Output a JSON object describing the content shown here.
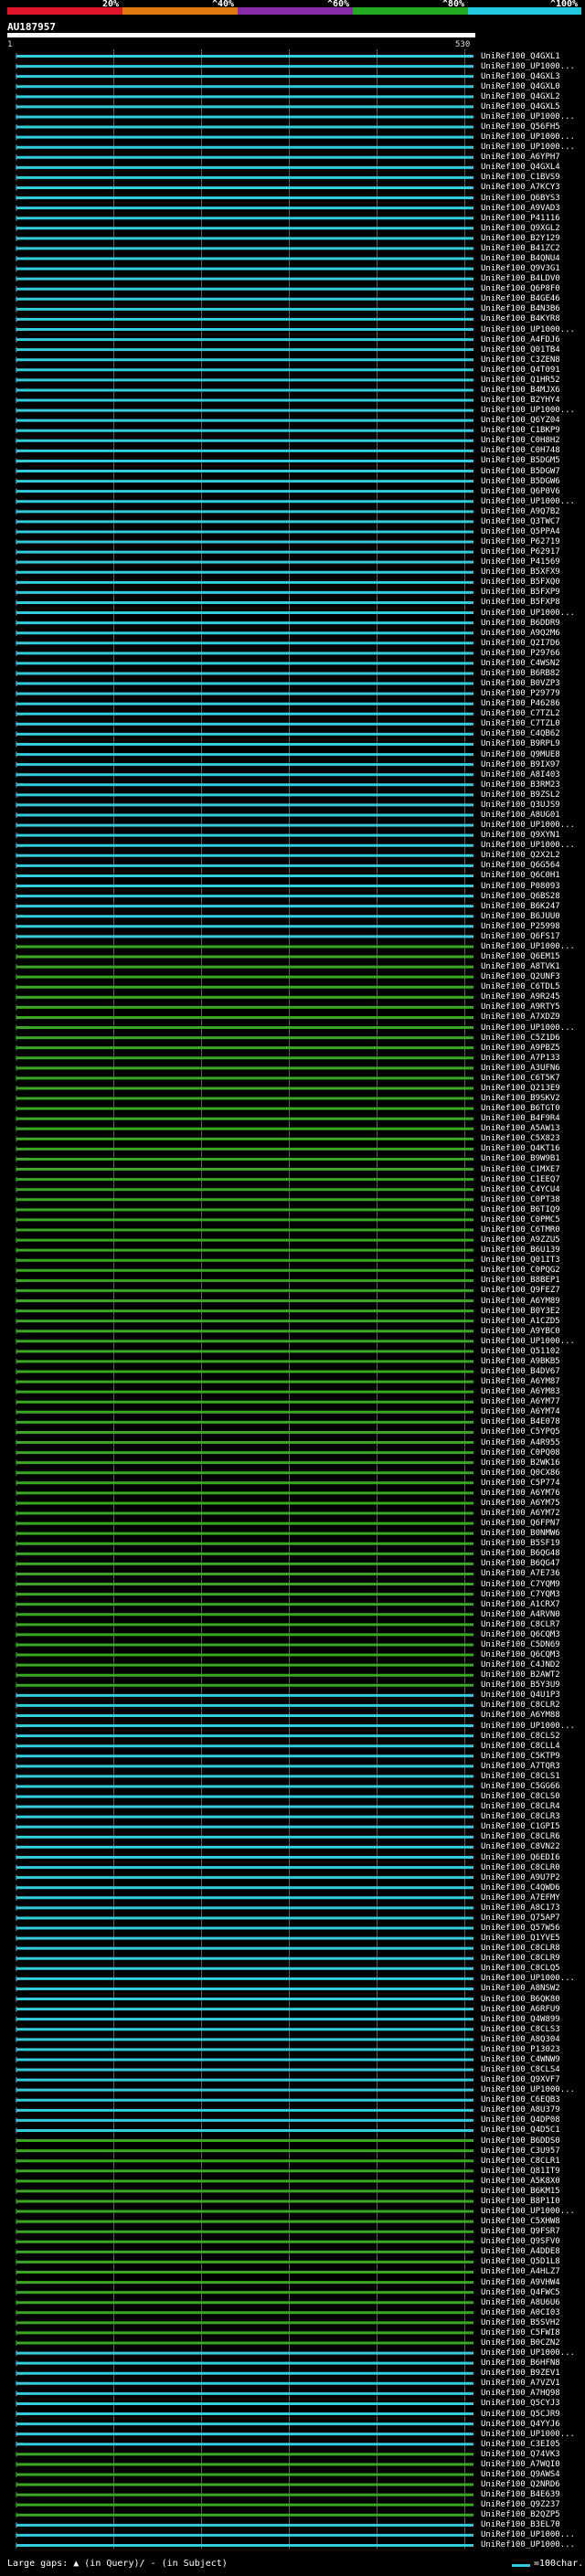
{
  "scale": {
    "ticks": [
      "20%",
      "^40%",
      "^60%",
      "^80%",
      "^100%"
    ],
    "colors": [
      "#e0152b",
      "#e07a10",
      "#8a2ba8",
      "#22aa22",
      "#22c8e0"
    ]
  },
  "query": {
    "title": "AU187957",
    "start": "1",
    "end": "530"
  },
  "legend": {
    "text": "Large gaps: ▲ (in Query)/ - (in Subject)",
    "unit": "=100char."
  },
  "colors": {
    "cyan": "#33ccdd",
    "green": "#3aa820",
    "white": "#ffffff"
  },
  "hits": [
    {
      "label": "UniRef100_Q4GXL1",
      "color": "cyan"
    },
    {
      "label": "UniRef100_UP1000...",
      "color": "cyan"
    },
    {
      "label": "UniRef100_Q4GXL3",
      "color": "cyan"
    },
    {
      "label": "UniRef100_Q4GXL0",
      "color": "cyan"
    },
    {
      "label": "UniRef100_Q4GXL2",
      "color": "cyan"
    },
    {
      "label": "UniRef100_Q4GXL5",
      "color": "cyan"
    },
    {
      "label": "UniRef100_UP1000...",
      "color": "cyan"
    },
    {
      "label": "UniRef100_Q56FH5",
      "color": "cyan"
    },
    {
      "label": "UniRef100_UP1000...",
      "color": "cyan"
    },
    {
      "label": "UniRef100_UP1000...",
      "color": "cyan"
    },
    {
      "label": "UniRef100_A6YPH7",
      "color": "cyan"
    },
    {
      "label": "UniRef100_Q4GXL4",
      "color": "cyan"
    },
    {
      "label": "UniRef100_C1BVS9",
      "color": "cyan"
    },
    {
      "label": "UniRef100_A7KCY3",
      "color": "cyan"
    },
    {
      "label": "UniRef100_Q6BYS3",
      "color": "cyan"
    },
    {
      "label": "UniRef100_A9VAD3",
      "color": "cyan"
    },
    {
      "label": "UniRef100_P41116",
      "color": "cyan"
    },
    {
      "label": "UniRef100_Q9XGL2",
      "color": "cyan"
    },
    {
      "label": "UniRef100_B2Y129",
      "color": "cyan"
    },
    {
      "label": "UniRef100_B41ZC2",
      "color": "cyan"
    },
    {
      "label": "UniRef100_B4QNU4",
      "color": "cyan"
    },
    {
      "label": "UniRef100_Q9V3G1",
      "color": "cyan"
    },
    {
      "label": "UniRef100_B4LDV0",
      "color": "cyan"
    },
    {
      "label": "UniRef100_Q6P8F0",
      "color": "cyan"
    },
    {
      "label": "UniRef100_B4GE46",
      "color": "cyan"
    },
    {
      "label": "UniRef100_B4N3B6",
      "color": "cyan"
    },
    {
      "label": "UniRef100_B4KYR8",
      "color": "cyan"
    },
    {
      "label": "UniRef100_UP1000...",
      "color": "cyan"
    },
    {
      "label": "UniRef100_A4FDJ6",
      "color": "cyan"
    },
    {
      "label": "UniRef100_Q01TB4",
      "color": "cyan"
    },
    {
      "label": "UniRef100_C3ZEN8",
      "color": "cyan"
    },
    {
      "label": "UniRef100_Q4T091",
      "color": "cyan"
    },
    {
      "label": "UniRef100_Q1HR52",
      "color": "cyan"
    },
    {
      "label": "UniRef100_B4MJX6",
      "color": "cyan"
    },
    {
      "label": "UniRef100_B2YHY4",
      "color": "cyan"
    },
    {
      "label": "UniRef100_UP1000...",
      "color": "cyan"
    },
    {
      "label": "UniRef100_Q6YZ04",
      "color": "cyan"
    },
    {
      "label": "UniRef100_C1BKP9",
      "color": "cyan"
    },
    {
      "label": "UniRef100_C0H8H2",
      "color": "cyan"
    },
    {
      "label": "UniRef100_C0H748",
      "color": "cyan"
    },
    {
      "label": "UniRef100_B5DGM5",
      "color": "cyan"
    },
    {
      "label": "UniRef100_B5DGW7",
      "color": "cyan"
    },
    {
      "label": "UniRef100_B5DGW6",
      "color": "cyan"
    },
    {
      "label": "UniRef100_Q6P0V6",
      "color": "cyan"
    },
    {
      "label": "UniRef100_UP1000...",
      "color": "cyan"
    },
    {
      "label": "UniRef100_A9Q7B2",
      "color": "cyan"
    },
    {
      "label": "UniRef100_Q3TWC7",
      "color": "cyan"
    },
    {
      "label": "UniRef100_Q5PPA4",
      "color": "cyan"
    },
    {
      "label": "UniRef100_P62719",
      "color": "cyan"
    },
    {
      "label": "UniRef100_P62917",
      "color": "cyan"
    },
    {
      "label": "UniRef100_P41569",
      "color": "cyan"
    },
    {
      "label": "UniRef100_B5XFX9",
      "color": "cyan"
    },
    {
      "label": "UniRef100_B5FXQ0",
      "color": "cyan"
    },
    {
      "label": "UniRef100_B5FXP9",
      "color": "cyan"
    },
    {
      "label": "UniRef100_B5FXP8",
      "color": "cyan"
    },
    {
      "label": "UniRef100_UP1000...",
      "color": "cyan"
    },
    {
      "label": "UniRef100_B6DDR9",
      "color": "cyan"
    },
    {
      "label": "UniRef100_A9Q2M6",
      "color": "cyan"
    },
    {
      "label": "UniRef100_Q2I7D6",
      "color": "cyan"
    },
    {
      "label": "UniRef100_P29766",
      "color": "cyan"
    },
    {
      "label": "UniRef100_C4WSN2",
      "color": "cyan"
    },
    {
      "label": "UniRef100_B6RB82",
      "color": "cyan"
    },
    {
      "label": "UniRef100_B0VZP3",
      "color": "cyan"
    },
    {
      "label": "UniRef100_P29779",
      "color": "cyan"
    },
    {
      "label": "UniRef100_P46286",
      "color": "cyan"
    },
    {
      "label": "UniRef100_C7TZL2",
      "color": "cyan"
    },
    {
      "label": "UniRef100_C7TZL0",
      "color": "cyan"
    },
    {
      "label": "UniRef100_C4QB62",
      "color": "cyan"
    },
    {
      "label": "UniRef100_B9RPL9",
      "color": "cyan"
    },
    {
      "label": "UniRef100_Q9MUE8",
      "color": "cyan"
    },
    {
      "label": "UniRef100_B9IX97",
      "color": "cyan"
    },
    {
      "label": "UniRef100_A8I403",
      "color": "cyan"
    },
    {
      "label": "UniRef100_B3RM23",
      "color": "cyan"
    },
    {
      "label": "UniRef100_B9ZSL2",
      "color": "cyan"
    },
    {
      "label": "UniRef100_Q3UJS9",
      "color": "cyan"
    },
    {
      "label": "UniRef100_A8UG01",
      "color": "cyan"
    },
    {
      "label": "UniRef100_UP1000...",
      "color": "cyan"
    },
    {
      "label": "UniRef100_Q9XYN1",
      "color": "cyan"
    },
    {
      "label": "UniRef100_UP1000...",
      "color": "cyan"
    },
    {
      "label": "UniRef100_Q2X2L2",
      "color": "cyan"
    },
    {
      "label": "UniRef100_Q6G564",
      "color": "cyan"
    },
    {
      "label": "UniRef100_Q6C0H1",
      "color": "cyan"
    },
    {
      "label": "UniRef100_P08093",
      "color": "cyan"
    },
    {
      "label": "UniRef100_Q6BS28",
      "color": "cyan"
    },
    {
      "label": "UniRef100_B6K247",
      "color": "cyan"
    },
    {
      "label": "UniRef100_B6JUU0",
      "color": "cyan"
    },
    {
      "label": "UniRef100_P25998",
      "color": "cyan"
    },
    {
      "label": "UniRef100_Q6FS17",
      "color": "cyan"
    },
    {
      "label": "UniRef100_UP1000...",
      "color": "green"
    },
    {
      "label": "UniRef100_Q6EM15",
      "color": "green"
    },
    {
      "label": "UniRef100_A8TVK1",
      "color": "green"
    },
    {
      "label": "UniRef100_Q2UNF3",
      "color": "green"
    },
    {
      "label": "UniRef100_C6TDL5",
      "color": "green"
    },
    {
      "label": "UniRef100_A9R245",
      "color": "green"
    },
    {
      "label": "UniRef100_A9RTY5",
      "color": "green"
    },
    {
      "label": "UniRef100_A7XDZ9",
      "color": "green"
    },
    {
      "label": "UniRef100_UP1000...",
      "color": "green"
    },
    {
      "label": "UniRef100_C5Z1D6",
      "color": "green"
    },
    {
      "label": "UniRef100_A9PBZ5",
      "color": "green"
    },
    {
      "label": "UniRef100_A7P133",
      "color": "green"
    },
    {
      "label": "UniRef100_A3UFN6",
      "color": "green"
    },
    {
      "label": "UniRef100_C6T5K7",
      "color": "green"
    },
    {
      "label": "UniRef100_Q213E9",
      "color": "green"
    },
    {
      "label": "UniRef100_B9SKV2",
      "color": "green"
    },
    {
      "label": "UniRef100_B6TGT0",
      "color": "green"
    },
    {
      "label": "UniRef100_B4F9R4",
      "color": "green"
    },
    {
      "label": "UniRef100_A5AW13",
      "color": "green"
    },
    {
      "label": "UniRef100_C5X823",
      "color": "green"
    },
    {
      "label": "UniRef100_Q4KT16",
      "color": "green"
    },
    {
      "label": "UniRef100_B9W9B1",
      "color": "green"
    },
    {
      "label": "UniRef100_C1MXE7",
      "color": "green"
    },
    {
      "label": "UniRef100_C1EEQ7",
      "color": "green"
    },
    {
      "label": "UniRef100_C4YCU4",
      "color": "green"
    },
    {
      "label": "UniRef100_C0PT38",
      "color": "green"
    },
    {
      "label": "UniRef100_B6TIQ9",
      "color": "green"
    },
    {
      "label": "UniRef100_C0PMC5",
      "color": "green"
    },
    {
      "label": "UniRef100_C6TMR0",
      "color": "green"
    },
    {
      "label": "UniRef100_A9ZZU5",
      "color": "green"
    },
    {
      "label": "UniRef100_B6U139",
      "color": "green"
    },
    {
      "label": "UniRef100_Q01IT3",
      "color": "green"
    },
    {
      "label": "UniRef100_C0PQG2",
      "color": "green"
    },
    {
      "label": "UniRef100_B8BEP1",
      "color": "green"
    },
    {
      "label": "UniRef100_Q9FEZ7",
      "color": "green"
    },
    {
      "label": "UniRef100_A6YM89",
      "color": "green"
    },
    {
      "label": "UniRef100_B0Y3E2",
      "color": "green"
    },
    {
      "label": "UniRef100_A1CZD5",
      "color": "green"
    },
    {
      "label": "UniRef100_A9YBC0",
      "color": "green"
    },
    {
      "label": "UniRef100_UP1000...",
      "color": "green"
    },
    {
      "label": "UniRef100_Q51102",
      "color": "green"
    },
    {
      "label": "UniRef100_A9BKB5",
      "color": "green"
    },
    {
      "label": "UniRef100_B4DV67",
      "color": "green"
    },
    {
      "label": "UniRef100_A6YM87",
      "color": "green"
    },
    {
      "label": "UniRef100_A6YM83",
      "color": "green"
    },
    {
      "label": "UniRef100_A6YM77",
      "color": "green"
    },
    {
      "label": "UniRef100_A6YM74",
      "color": "green"
    },
    {
      "label": "UniRef100_B4E078",
      "color": "green"
    },
    {
      "label": "UniRef100_C5YPQ5",
      "color": "green"
    },
    {
      "label": "UniRef100_A4R955",
      "color": "green"
    },
    {
      "label": "UniRef100_C0PQ08",
      "color": "green"
    },
    {
      "label": "UniRef100_B2WK16",
      "color": "green"
    },
    {
      "label": "UniRef100_Q0CX86",
      "color": "green"
    },
    {
      "label": "UniRef100_C5P774",
      "color": "green"
    },
    {
      "label": "UniRef100_A6YM76",
      "color": "green"
    },
    {
      "label": "UniRef100_A6YM75",
      "color": "green"
    },
    {
      "label": "UniRef100_A6YM72",
      "color": "green"
    },
    {
      "label": "UniRef100_Q6FPN7",
      "color": "green"
    },
    {
      "label": "UniRef100_B0NMW6",
      "color": "green"
    },
    {
      "label": "UniRef100_B5SF19",
      "color": "green"
    },
    {
      "label": "UniRef100_B6QG48",
      "color": "green"
    },
    {
      "label": "UniRef100_B6QG47",
      "color": "green"
    },
    {
      "label": "UniRef100_A7E736",
      "color": "green"
    },
    {
      "label": "UniRef100_C7YQM9",
      "color": "green"
    },
    {
      "label": "UniRef100_C7YQM3",
      "color": "green"
    },
    {
      "label": "UniRef100_A1CRX7",
      "color": "green"
    },
    {
      "label": "UniRef100_A4RVN0",
      "color": "green"
    },
    {
      "label": "UniRef100_C8CLR7",
      "color": "green"
    },
    {
      "label": "UniRef100_Q6CQM3",
      "color": "green"
    },
    {
      "label": "UniRef100_C5DN69",
      "color": "green"
    },
    {
      "label": "UniRef100_Q6CQM3",
      "color": "green"
    },
    {
      "label": "UniRef100_C4JND2",
      "color": "green"
    },
    {
      "label": "UniRef100_B2AWT2",
      "color": "green"
    },
    {
      "label": "UniRef100_B5Y3U9",
      "color": "green"
    },
    {
      "label": "UniRef100_Q4U1P3",
      "color": "cyan"
    },
    {
      "label": "UniRef100_C8CLR2",
      "color": "cyan"
    },
    {
      "label": "UniRef100_A6YM88",
      "color": "cyan"
    },
    {
      "label": "UniRef100_UP1000...",
      "color": "cyan"
    },
    {
      "label": "UniRef100_C8CLS2",
      "color": "cyan"
    },
    {
      "label": "UniRef100_C8CLL4",
      "color": "cyan"
    },
    {
      "label": "UniRef100_C5KTP9",
      "color": "cyan"
    },
    {
      "label": "UniRef100_A7TQR3",
      "color": "cyan"
    },
    {
      "label": "UniRef100_C8CLS1",
      "color": "cyan"
    },
    {
      "label": "UniRef100_C5GG66",
      "color": "cyan"
    },
    {
      "label": "UniRef100_C8CLS0",
      "color": "cyan"
    },
    {
      "label": "UniRef100_C8CLR4",
      "color": "cyan"
    },
    {
      "label": "UniRef100_C8CLR3",
      "color": "cyan"
    },
    {
      "label": "UniRef100_C1GPI5",
      "color": "cyan"
    },
    {
      "label": "UniRef100_C8CLR6",
      "color": "cyan"
    },
    {
      "label": "UniRef100_C8VN22",
      "color": "cyan"
    },
    {
      "label": "UniRef100_Q6EDI6",
      "color": "cyan"
    },
    {
      "label": "UniRef100_C8CLR0",
      "color": "cyan"
    },
    {
      "label": "UniRef100_A9U7P2",
      "color": "cyan"
    },
    {
      "label": "UniRef100_C4QWD6",
      "color": "cyan"
    },
    {
      "label": "UniRef100_A7EFMY",
      "color": "cyan"
    },
    {
      "label": "UniRef100_A8C173",
      "color": "cyan"
    },
    {
      "label": "UniRef100_Q75AP7",
      "color": "cyan"
    },
    {
      "label": "UniRef100_Q57W56",
      "color": "cyan"
    },
    {
      "label": "UniRef100_Q1YVE5",
      "color": "cyan"
    },
    {
      "label": "UniRef100_C8CLR8",
      "color": "cyan"
    },
    {
      "label": "UniRef100_C8CLR9",
      "color": "cyan"
    },
    {
      "label": "UniRef100_C8CLQ5",
      "color": "cyan"
    },
    {
      "label": "UniRef100_UP1000...",
      "color": "cyan"
    },
    {
      "label": "UniRef100_A8NSW2",
      "color": "cyan"
    },
    {
      "label": "UniRef100_B6QK80",
      "color": "cyan"
    },
    {
      "label": "UniRef100_A6RFU9",
      "color": "cyan"
    },
    {
      "label": "UniRef100_Q4W899",
      "color": "cyan"
    },
    {
      "label": "UniRef100_C8CLS3",
      "color": "cyan"
    },
    {
      "label": "UniRef100_A8Q304",
      "color": "cyan"
    },
    {
      "label": "UniRef100_P13023",
      "color": "cyan"
    },
    {
      "label": "UniRef100_C4WNW9",
      "color": "cyan"
    },
    {
      "label": "UniRef100_C8CLS4",
      "color": "cyan"
    },
    {
      "label": "UniRef100_Q9XVF7",
      "color": "cyan"
    },
    {
      "label": "UniRef100_UP1000...",
      "color": "cyan"
    },
    {
      "label": "UniRef100_C6EQB3",
      "color": "cyan"
    },
    {
      "label": "UniRef100_A8U379",
      "color": "cyan"
    },
    {
      "label": "UniRef100_Q4DP08",
      "color": "cyan"
    },
    {
      "label": "UniRef100_Q4D5C1",
      "color": "cyan"
    },
    {
      "label": "UniRef100_B6DDS0",
      "color": "green"
    },
    {
      "label": "UniRef100_C3U957",
      "color": "green"
    },
    {
      "label": "UniRef100_C8CLR1",
      "color": "green"
    },
    {
      "label": "UniRef100_Q81IT9",
      "color": "green"
    },
    {
      "label": "UniRef100_A5K8X0",
      "color": "green"
    },
    {
      "label": "UniRef100_B6KM15",
      "color": "green"
    },
    {
      "label": "UniRef100_B8P1I0",
      "color": "green"
    },
    {
      "label": "UniRef100_UP1000...",
      "color": "green"
    },
    {
      "label": "UniRef100_C5XHW8",
      "color": "green"
    },
    {
      "label": "UniRef100_Q9FSR7",
      "color": "green"
    },
    {
      "label": "UniRef100_Q9SFV0",
      "color": "green"
    },
    {
      "label": "UniRef100_A4DDE8",
      "color": "green"
    },
    {
      "label": "UniRef100_Q5D1L8",
      "color": "green"
    },
    {
      "label": "UniRef100_A4HLZ7",
      "color": "green"
    },
    {
      "label": "UniRef100_A9VHW4",
      "color": "green"
    },
    {
      "label": "UniRef100_Q4FWC5",
      "color": "green"
    },
    {
      "label": "UniRef100_A8U6U6",
      "color": "green"
    },
    {
      "label": "UniRef100_A0CI03",
      "color": "green"
    },
    {
      "label": "UniRef100_B5SVH2",
      "color": "green"
    },
    {
      "label": "UniRef100_C5FWI8",
      "color": "green"
    },
    {
      "label": "UniRef100_B0CZN2",
      "color": "green"
    },
    {
      "label": "UniRef100_UP1000...",
      "color": "cyan"
    },
    {
      "label": "UniRef100_B6HFN8",
      "color": "cyan"
    },
    {
      "label": "UniRef100_B9ZEV1",
      "color": "cyan"
    },
    {
      "label": "UniRef100_A7VZV1",
      "color": "cyan"
    },
    {
      "label": "UniRef100_A7HQ98",
      "color": "cyan"
    },
    {
      "label": "UniRef100_Q5CYJ3",
      "color": "cyan"
    },
    {
      "label": "UniRef100_Q5CJR9",
      "color": "cyan"
    },
    {
      "label": "UniRef100_Q4YYJ6",
      "color": "cyan"
    },
    {
      "label": "UniRef100_UP1000...",
      "color": "cyan"
    },
    {
      "label": "UniRef100_C3EI05",
      "color": "cyan"
    },
    {
      "label": "UniRef100_Q74VK3",
      "color": "green"
    },
    {
      "label": "UniRef100_A7WQI0",
      "color": "green"
    },
    {
      "label": "UniRef100_Q9AWS4",
      "color": "green"
    },
    {
      "label": "UniRef100_Q2NRD6",
      "color": "green"
    },
    {
      "label": "UniRef100_B4E639",
      "color": "green"
    },
    {
      "label": "UniRef100_Q9Z237",
      "color": "green"
    },
    {
      "label": "UniRef100_B2QZP5",
      "color": "green"
    },
    {
      "label": "UniRef100_B3EL70",
      "color": "cyan"
    },
    {
      "label": "UniRef100_UP1000...",
      "color": "cyan"
    },
    {
      "label": "UniRef100_UP1000...",
      "color": "cyan"
    }
  ]
}
